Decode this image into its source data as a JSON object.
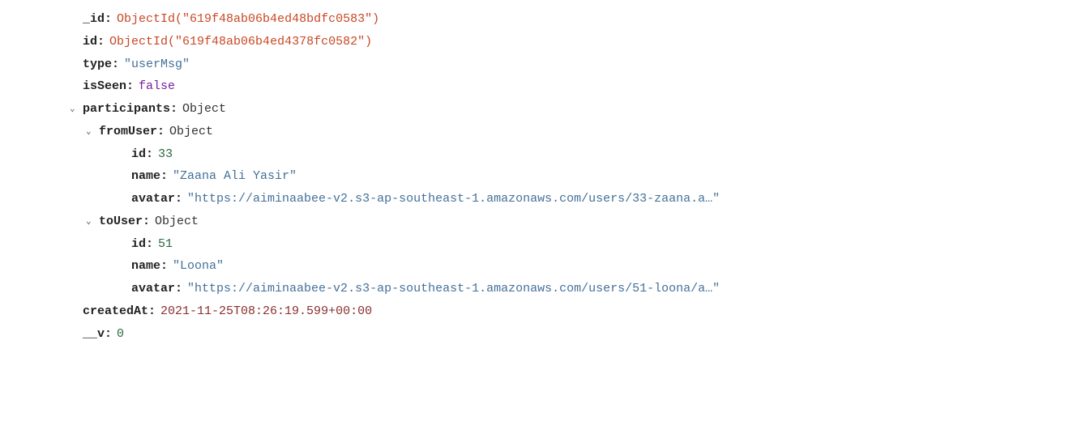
{
  "doc": {
    "field_id_key": "_id",
    "field_id_val": "ObjectId(\"619f48ab06b4ed48bdfc0583\")",
    "id_key": "id",
    "id_val": "ObjectId(\"619f48ab06b4ed4378fc0582\")",
    "type_key": "type",
    "type_val": "\"userMsg\"",
    "isSeen_key": "isSeen",
    "isSeen_val": "false",
    "participants_key": "participants",
    "object_label": "Object",
    "fromUser_key": "fromUser",
    "fromUser": {
      "id_key": "id",
      "id_val": "33",
      "name_key": "name",
      "name_val": "\"Zaana Ali Yasir\"",
      "avatar_key": "avatar",
      "avatar_val": "\"https://aiminaabee-v2.s3-ap-southeast-1.amazonaws.com/users/33-zaana.a…\""
    },
    "toUser_key": "toUser",
    "toUser": {
      "id_key": "id",
      "id_val": "51",
      "name_key": "name",
      "name_val": "\"Loona\"",
      "avatar_key": "avatar",
      "avatar_val": "\"https://aiminaabee-v2.s3-ap-southeast-1.amazonaws.com/users/51-loona/a…\""
    },
    "createdAt_key": "createdAt",
    "createdAt_val": "2021-11-25T08:26:19.599+00:00",
    "v_key": "__v",
    "v_val": "0"
  }
}
